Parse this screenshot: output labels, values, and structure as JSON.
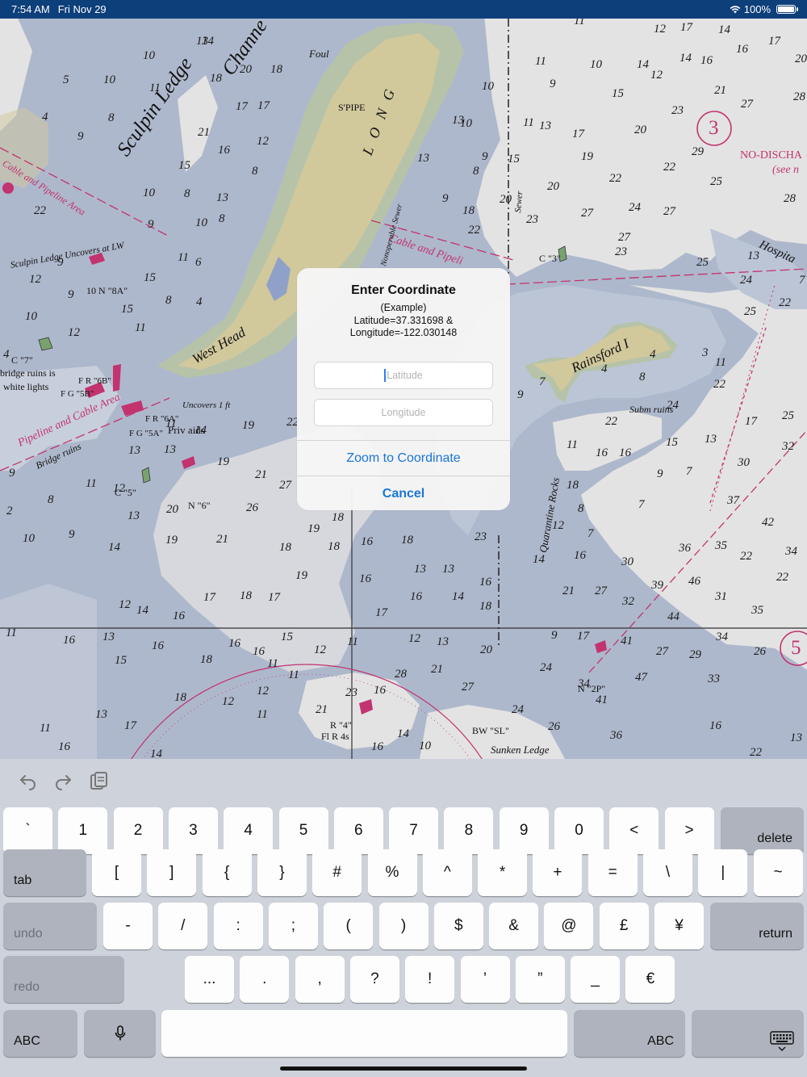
{
  "status_bar": {
    "time": "7:54 AM",
    "date": "Fri Nov 29",
    "battery": "100%"
  },
  "chart": {
    "soundings": [
      [
        "13",
        243,
        52
      ],
      [
        "14",
        250,
        52
      ],
      [
        "10",
        177,
        70
      ],
      [
        "18",
        260,
        98
      ],
      [
        "20",
        297,
        87
      ],
      [
        "11",
        185,
        110
      ],
      [
        "10",
        128,
        100
      ],
      [
        "5",
        78,
        100
      ],
      [
        "4",
        52,
        146
      ],
      [
        "8",
        134,
        147
      ],
      [
        "9",
        96,
        170
      ],
      [
        "21",
        245,
        165
      ],
      [
        "16",
        270,
        187
      ],
      [
        "17",
        292,
        133
      ],
      [
        "17",
        319,
        132
      ],
      [
        "18",
        335,
        87
      ],
      [
        "12",
        318,
        176
      ],
      [
        "15",
        221,
        206
      ],
      [
        "10",
        177,
        240
      ],
      [
        "8",
        228,
        241
      ],
      [
        "13",
        268,
        246
      ],
      [
        "8",
        312,
        213
      ],
      [
        "8",
        271,
        272
      ],
      [
        "10",
        242,
        277
      ],
      [
        "22",
        42,
        262
      ],
      [
        "9",
        183,
        279
      ],
      [
        "12",
        36,
        347
      ],
      [
        "9",
        71,
        326
      ],
      [
        "11",
        220,
        320
      ],
      [
        "6",
        242,
        326
      ],
      [
        "15",
        178,
        345
      ],
      [
        "8",
        205,
        373
      ],
      [
        "4",
        243,
        375
      ],
      [
        "9",
        84,
        366
      ],
      [
        "10",
        31,
        393
      ],
      [
        "15",
        150,
        384
      ],
      [
        "12",
        84,
        413
      ],
      [
        "11",
        167,
        407
      ],
      [
        "4",
        4,
        440
      ],
      [
        "11",
        205,
        526
      ],
      [
        "14",
        241,
        534
      ],
      [
        "19",
        300,
        528
      ],
      [
        "22",
        355,
        524
      ],
      [
        "13",
        159,
        559
      ],
      [
        "13",
        203,
        558
      ],
      [
        "19",
        269,
        573
      ],
      [
        "21",
        316,
        589
      ],
      [
        "27",
        346,
        602
      ],
      [
        "11",
        106,
        600
      ],
      [
        "12",
        140,
        606
      ],
      [
        "9",
        11,
        587
      ],
      [
        "8",
        59,
        620
      ],
      [
        "2",
        8,
        634
      ],
      [
        "20",
        206,
        632
      ],
      [
        "26",
        305,
        630
      ],
      [
        "13",
        158,
        640
      ],
      [
        "19",
        381,
        656
      ],
      [
        "18",
        411,
        642
      ],
      [
        "16",
        447,
        672
      ],
      [
        "18",
        497,
        670
      ],
      [
        "23",
        588,
        666
      ],
      [
        "10",
        28,
        668
      ],
      [
        "9",
        85,
        663
      ],
      [
        "14",
        134,
        679
      ],
      [
        "19",
        205,
        670
      ],
      [
        "21",
        268,
        669
      ],
      [
        "18",
        346,
        679
      ],
      [
        "18",
        406,
        678
      ],
      [
        "19",
        366,
        714
      ],
      [
        "16",
        445,
        718
      ],
      [
        "13",
        513,
        706
      ],
      [
        "13",
        548,
        706
      ],
      [
        "16",
        594,
        722
      ],
      [
        "14",
        560,
        740
      ],
      [
        "18",
        594,
        752
      ],
      [
        "14",
        169,
        757
      ],
      [
        "17",
        252,
        741
      ],
      [
        "18",
        297,
        739
      ],
      [
        "17",
        332,
        741
      ],
      [
        "16",
        214,
        764
      ],
      [
        "16",
        508,
        740
      ],
      [
        "17",
        465,
        760
      ],
      [
        "12",
        147,
        750
      ],
      [
        "14",
        660,
        694
      ],
      [
        "16",
        711,
        689
      ],
      [
        "21",
        697,
        733
      ],
      [
        "27",
        737,
        733
      ],
      [
        "30",
        770,
        697
      ],
      [
        "32",
        771,
        746
      ],
      [
        "39",
        807,
        726
      ],
      [
        "46",
        853,
        721
      ],
      [
        "31",
        886,
        740
      ],
      [
        "44",
        827,
        765
      ],
      [
        "35",
        931,
        757
      ],
      [
        "22",
        962,
        716
      ],
      [
        "22",
        917,
        690
      ],
      [
        "36",
        841,
        680
      ],
      [
        "35",
        886,
        677
      ],
      [
        "34",
        973,
        684
      ],
      [
        "42",
        944,
        648
      ],
      [
        "37",
        901,
        621
      ],
      [
        "30",
        914,
        574
      ],
      [
        "32",
        969,
        554
      ],
      [
        "25",
        969,
        516
      ],
      [
        "17",
        923,
        523
      ],
      [
        "13",
        873,
        545
      ],
      [
        "15",
        825,
        549
      ],
      [
        "22",
        750,
        523
      ],
      [
        "16",
        767,
        562
      ],
      [
        "9",
        814,
        588
      ],
      [
        "7",
        850,
        585
      ],
      [
        "18",
        702,
        602
      ],
      [
        "8",
        716,
        631
      ],
      [
        "7",
        791,
        626
      ],
      [
        "12",
        684,
        652
      ],
      [
        "7",
        728,
        662
      ],
      [
        "11",
        7,
        785
      ],
      [
        "16",
        78,
        794
      ],
      [
        "13",
        127,
        790
      ],
      [
        "16",
        188,
        801
      ],
      [
        "16",
        283,
        798
      ],
      [
        "16",
        313,
        808
      ],
      [
        "15",
        348,
        790
      ],
      [
        "12",
        389,
        806
      ],
      [
        "11",
        430,
        796
      ],
      [
        "12",
        506,
        792
      ],
      [
        "13",
        541,
        796
      ],
      [
        "20",
        595,
        806
      ],
      [
        "17",
        715,
        789
      ],
      [
        "9",
        683,
        788
      ],
      [
        "41",
        769,
        795
      ],
      [
        "34",
        887,
        790
      ],
      [
        "27",
        813,
        808
      ],
      [
        "29",
        854,
        812
      ],
      [
        "26",
        934,
        808
      ],
      [
        "47",
        787,
        840
      ],
      [
        "33",
        877,
        842
      ],
      [
        "34",
        716,
        848
      ],
      [
        "41",
        738,
        868
      ],
      [
        "28",
        489,
        836
      ],
      [
        "21",
        534,
        830
      ],
      [
        "27",
        572,
        852
      ],
      [
        "24",
        669,
        828
      ],
      [
        "18",
        248,
        818
      ],
      [
        "11",
        331,
        823
      ],
      [
        "11",
        357,
        837
      ],
      [
        "12",
        318,
        857
      ],
      [
        "12",
        275,
        870
      ],
      [
        "11",
        318,
        886
      ],
      [
        "18",
        216,
        865
      ],
      [
        "17",
        154,
        900
      ],
      [
        "11",
        49,
        903
      ],
      [
        "16",
        72,
        926
      ],
      [
        "14",
        186,
        935
      ],
      [
        "16",
        460,
        926
      ],
      [
        "14",
        492,
        910
      ],
      [
        "10",
        519,
        925
      ],
      [
        "24",
        634,
        880
      ],
      [
        "26",
        679,
        901
      ],
      [
        "36",
        756,
        912
      ],
      [
        "16",
        879,
        900
      ],
      [
        "22",
        929,
        933
      ],
      [
        "13",
        979,
        915
      ],
      [
        "21",
        391,
        880
      ],
      [
        "23",
        428,
        859
      ],
      [
        "16",
        463,
        856
      ],
      [
        "13",
        118,
        886
      ],
      [
        "15",
        142,
        819
      ],
      [
        "11",
        711,
        27
      ],
      [
        "12",
        810,
        37
      ],
      [
        "17",
        843,
        35
      ],
      [
        "14",
        890,
        38
      ],
      [
        "16",
        912,
        62
      ],
      [
        "17",
        952,
        52
      ],
      [
        "20",
        985,
        74
      ],
      [
        "14",
        842,
        73
      ],
      [
        "16",
        868,
        76
      ],
      [
        "11",
        663,
        77
      ],
      [
        "10",
        731,
        81
      ],
      [
        "14",
        789,
        81
      ],
      [
        "12",
        806,
        94
      ],
      [
        "9",
        681,
        105
      ],
      [
        "15",
        758,
        117
      ],
      [
        "21",
        885,
        113
      ],
      [
        "27",
        918,
        130
      ],
      [
        "28",
        983,
        121
      ],
      [
        "23",
        832,
        138
      ],
      [
        "20",
        786,
        162
      ],
      [
        "17",
        709,
        167
      ],
      [
        "13",
        668,
        157
      ],
      [
        "11",
        648,
        153
      ],
      [
        "19",
        720,
        195
      ],
      [
        "29",
        857,
        189
      ],
      [
        "22",
        822,
        208
      ],
      [
        "25",
        880,
        226
      ],
      [
        "28",
        971,
        247
      ],
      [
        "22",
        755,
        222
      ],
      [
        "20",
        678,
        232
      ],
      [
        "24",
        779,
        258
      ],
      [
        "27",
        822,
        263
      ],
      [
        "27",
        720,
        265
      ],
      [
        "27",
        766,
        295
      ],
      [
        "23",
        762,
        313
      ],
      [
        "13",
        926,
        318
      ],
      [
        "25",
        863,
        326
      ],
      [
        "24",
        917,
        348
      ],
      [
        "22",
        965,
        376
      ],
      [
        "25",
        922,
        387
      ],
      [
        "7",
        990,
        348
      ],
      [
        "20",
        619,
        248
      ],
      [
        "23",
        652,
        273
      ],
      [
        "22",
        580,
        286
      ],
      [
        "18",
        573,
        262
      ],
      [
        "9",
        548,
        247
      ],
      [
        "13",
        560,
        150
      ],
      [
        "10",
        570,
        154
      ],
      [
        "10",
        597,
        108
      ],
      [
        "8",
        586,
        213
      ],
      [
        "13",
        517,
        197
      ],
      [
        "15",
        629,
        198
      ],
      [
        "9",
        597,
        195
      ],
      [
        "22",
        884,
        477
      ],
      [
        "24",
        826,
        503
      ],
      [
        "8",
        792,
        468
      ],
      [
        "11",
        886,
        450
      ],
      [
        "3",
        870,
        438
      ],
      [
        "4",
        745,
        458
      ],
      [
        "4",
        805,
        440
      ],
      [
        "9",
        641,
        490
      ],
      [
        "7",
        668,
        474
      ],
      [
        "11",
        702,
        552
      ],
      [
        "16",
        738,
        562
      ]
    ],
    "labels": {
      "sculpin_ledge": "Sculpin Ledge",
      "channel": "Channe",
      "west_head": "West Head",
      "long": "L O N G",
      "rainsford": "Rainsford I",
      "hospital": "Hospita",
      "quarantine": "Quarantine Rocks",
      "sunken_ledge": "Sunken Ledge",
      "no_discharge": "NO-DISCHA",
      "see": "(see n",
      "cable_pipeline_1": "Cable and Pipeline Area",
      "cable_pipeline_2": "Cable and Pipeli",
      "pipeline_cable": "Pipeline and Cable Area",
      "sculpin_uncovers": "Sculpin Ledge Uncovers at LW",
      "bridge_ruins": "Bridge ruins",
      "bridge_ruins_is": "bridge ruins is",
      "white_lights": "white lights",
      "priv_aids": "Priv aids",
      "spipe": "S'PIPE",
      "foul": "Foul",
      "subm_ruins": "Subm ruins",
      "n8a": "10 N \"8A\"",
      "c7": "C \"7\"",
      "c3": "C \"3\"",
      "c5": "C \"5\"",
      "n6": "N \"6\"",
      "n2p": "N \"2P\"",
      "r4": "R \"4\"",
      "fr4s": "Fl R 4s",
      "bw_sl": "BW \"SL\"",
      "fr6b": "F R \"6B\"",
      "fg5b": "F G \"5B\"",
      "fr6a": "F R \"6A\"",
      "fg5a": "F G \"5A\"",
      "uncovers": "Uncovers 1 ft",
      "sewer": "Sewer",
      "outfall": "Nonoperable Sewer"
    },
    "circled_numbers": {
      "three": "3",
      "five": "5"
    }
  },
  "dialog": {
    "title": "Enter Coordinate",
    "example_line1": "(Example)",
    "example_line2": "Latitude=37.331698 &",
    "example_line3": "Longitude=-122.030148",
    "latitude_placeholder": "Latitude",
    "longitude_placeholder": "Longitude",
    "zoom_button": "Zoom to Coordinate",
    "cancel_button": "Cancel"
  },
  "keyboard": {
    "row1": [
      "`",
      "1",
      "2",
      "3",
      "4",
      "5",
      "6",
      "7",
      "8",
      "9",
      "0",
      "<",
      ">"
    ],
    "row1_delete": "delete",
    "row2_tab": "tab",
    "row2": [
      "[",
      "]",
      "{",
      "}",
      "#",
      "%",
      "^",
      "*",
      "+",
      "=",
      "\\",
      "|",
      "~"
    ],
    "row3_undo": "undo",
    "row3": [
      "-",
      "/",
      ":",
      ";",
      "(",
      ")",
      "$",
      "&",
      "@",
      "£",
      "¥"
    ],
    "row3_return": "return",
    "row4_redo": "redo",
    "row4": [
      "...",
      ".",
      ",",
      "?",
      "!",
      "’",
      "”",
      "_",
      "€"
    ],
    "row5_abc_left": "ABC",
    "row5_abc_right": "ABC"
  },
  "colors": {
    "status_bar": "#0d3f7a",
    "deep_water": "#aeb8cc",
    "shallow_water": "#e3e3e3",
    "land": "#d1c89c",
    "magenta": "#c2336f",
    "link_blue": "#1a76d6"
  }
}
